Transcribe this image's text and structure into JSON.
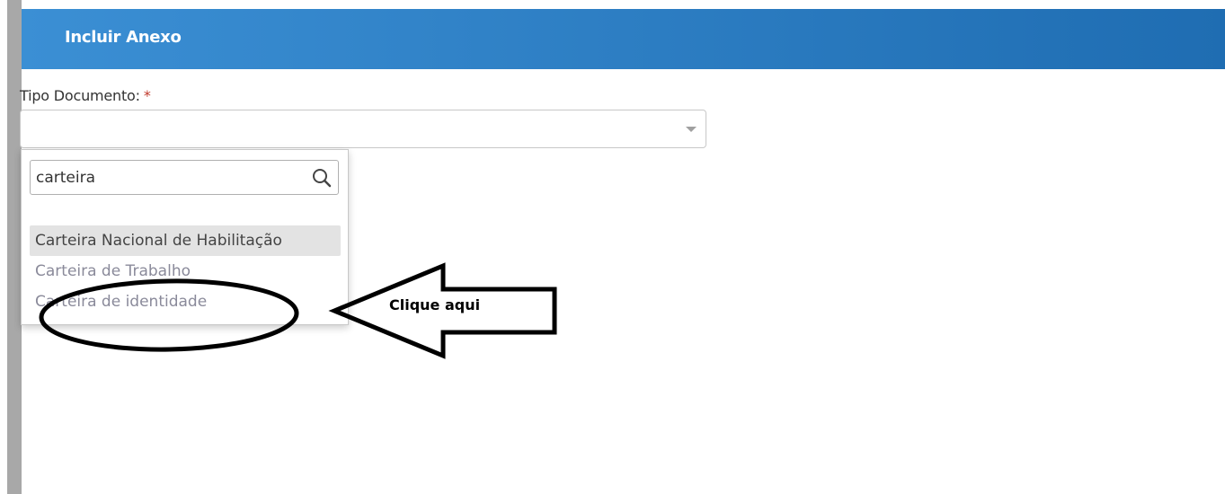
{
  "modal": {
    "title": "Incluir Anexo",
    "header_color": "#2a7fc8"
  },
  "form": {
    "tipo_documento": {
      "label": "Tipo Documento:",
      "required_marker": "*",
      "selected_value": ""
    }
  },
  "dropdown": {
    "search": {
      "value": "carteira",
      "icon": "search-icon"
    },
    "options": [
      {
        "label": "Carteira Nacional de Habilitação",
        "highlighted": true
      },
      {
        "label": "Carteira de Trabalho",
        "highlighted": false
      },
      {
        "label": "Carteira de identidade",
        "highlighted": false
      }
    ]
  },
  "annotation": {
    "text": "Clique aqui",
    "shape": "arrow-left-with-ellipse"
  }
}
